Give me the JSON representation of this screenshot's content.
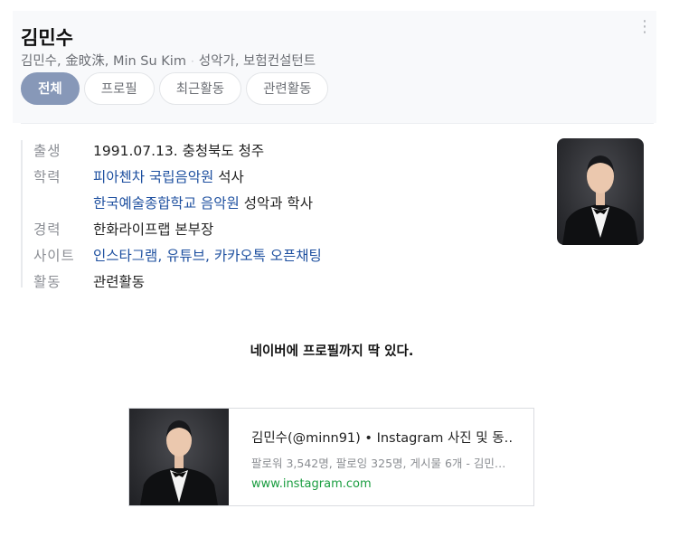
{
  "profile": {
    "name": "김민수",
    "aliases": "김민수, 金旼洙, Min Su Kim",
    "separator": "·",
    "occupation": "성악가, 보험컨설턴트",
    "more_icon": "⋮"
  },
  "tabs": [
    {
      "label": "전체",
      "active": true
    },
    {
      "label": "프로필",
      "active": false
    },
    {
      "label": "최근활동",
      "active": false
    },
    {
      "label": "관련활동",
      "active": false
    }
  ],
  "info": {
    "birth": {
      "label": "출생",
      "value": "1991.07.13. 충청북도 청주"
    },
    "education": {
      "label": "학력",
      "entries": [
        {
          "link": "피아첸차 국립음악원",
          "rest": " 석사"
        },
        {
          "link": "한국예술종합학교 음악원",
          "rest": " 성악과 학사"
        }
      ]
    },
    "career": {
      "label": "경력",
      "value": "한화라이프랩 본부장"
    },
    "sites": {
      "label": "사이트",
      "links": [
        "인스타그램",
        "유튜브",
        "카카오톡 오픈채팅"
      ],
      "sep": ", "
    },
    "activity": {
      "label": "활동",
      "link": "관련활동"
    }
  },
  "caption": "네이버에 프로필까지 딱 있다.",
  "instagram_card": {
    "title": "김민수(@minn91) • Instagram 사진 및 동…",
    "description": "팔로워 3,542명, 팔로잉 325명, 게시물 6개 - 김민…",
    "url": "www.instagram.com"
  }
}
